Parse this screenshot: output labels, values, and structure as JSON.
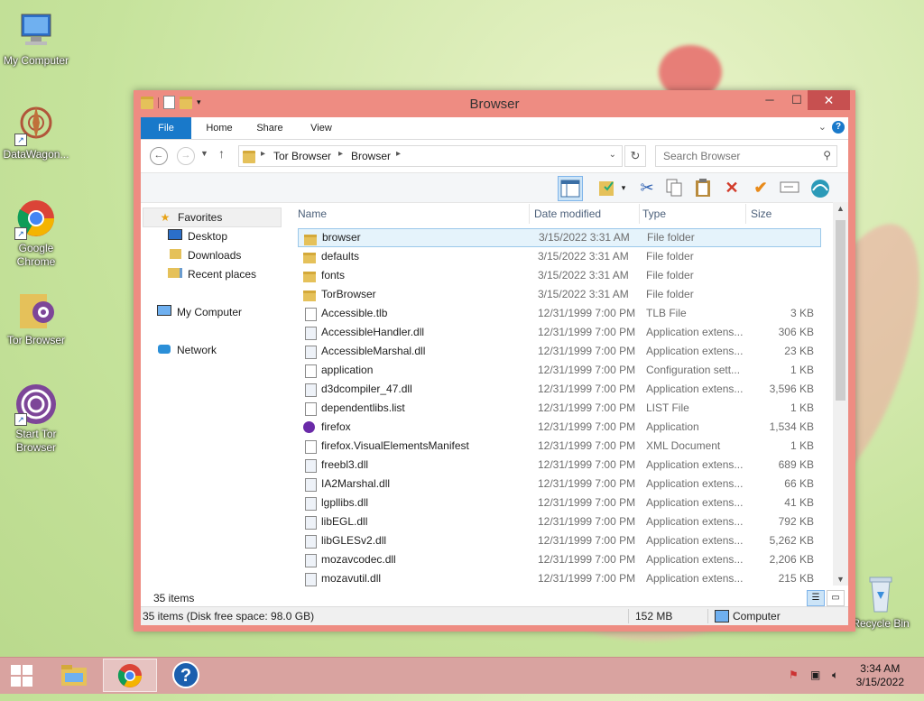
{
  "desktop": {
    "icons": [
      {
        "label": "My Computer",
        "icon": "my-computer-icon"
      },
      {
        "label": "DataWagon...",
        "icon": "datawagon-icon"
      },
      {
        "label": "Google Chrome",
        "icon": "chrome-icon"
      },
      {
        "label": "Tor Browser",
        "icon": "tor-folder-icon"
      },
      {
        "label": "Start Tor Browser",
        "icon": "tor-icon"
      },
      {
        "label": "Recycle Bin",
        "icon": "recycle-bin-icon"
      }
    ]
  },
  "window": {
    "title": "Browser",
    "ribbon": {
      "file": "File",
      "home": "Home",
      "share": "Share",
      "view": "View"
    },
    "address": {
      "crumb1": "Tor Browser",
      "crumb2": "Browser"
    },
    "search": {
      "placeholder": "Search Browser"
    },
    "nav": {
      "favorites": "Favorites",
      "desktop": "Desktop",
      "downloads": "Downloads",
      "recent": "Recent places",
      "computer": "My Computer",
      "network": "Network"
    },
    "columns": {
      "name": "Name",
      "date": "Date modified",
      "type": "Type",
      "size": "Size"
    },
    "files": [
      {
        "name": "browser",
        "date": "3/15/2022 3:31 AM",
        "type": "File folder",
        "size": "",
        "kind": "folder"
      },
      {
        "name": "defaults",
        "date": "3/15/2022 3:31 AM",
        "type": "File folder",
        "size": "",
        "kind": "folder"
      },
      {
        "name": "fonts",
        "date": "3/15/2022 3:31 AM",
        "type": "File folder",
        "size": "",
        "kind": "folder"
      },
      {
        "name": "TorBrowser",
        "date": "3/15/2022 3:31 AM",
        "type": "File folder",
        "size": "",
        "kind": "folder"
      },
      {
        "name": "Accessible.tlb",
        "date": "12/31/1999 7:00 PM",
        "type": "TLB File",
        "size": "3 KB",
        "kind": "file"
      },
      {
        "name": "AccessibleHandler.dll",
        "date": "12/31/1999 7:00 PM",
        "type": "Application extens...",
        "size": "306 KB",
        "kind": "dll"
      },
      {
        "name": "AccessibleMarshal.dll",
        "date": "12/31/1999 7:00 PM",
        "type": "Application extens...",
        "size": "23 KB",
        "kind": "dll"
      },
      {
        "name": "application",
        "date": "12/31/1999 7:00 PM",
        "type": "Configuration sett...",
        "size": "1 KB",
        "kind": "file"
      },
      {
        "name": "d3dcompiler_47.dll",
        "date": "12/31/1999 7:00 PM",
        "type": "Application extens...",
        "size": "3,596 KB",
        "kind": "dll"
      },
      {
        "name": "dependentlibs.list",
        "date": "12/31/1999 7:00 PM",
        "type": "LIST File",
        "size": "1 KB",
        "kind": "file"
      },
      {
        "name": "firefox",
        "date": "12/31/1999 7:00 PM",
        "type": "Application",
        "size": "1,534 KB",
        "kind": "ff"
      },
      {
        "name": "firefox.VisualElementsManifest",
        "date": "12/31/1999 7:00 PM",
        "type": "XML Document",
        "size": "1 KB",
        "kind": "file"
      },
      {
        "name": "freebl3.dll",
        "date": "12/31/1999 7:00 PM",
        "type": "Application extens...",
        "size": "689 KB",
        "kind": "dll"
      },
      {
        "name": "IA2Marshal.dll",
        "date": "12/31/1999 7:00 PM",
        "type": "Application extens...",
        "size": "66 KB",
        "kind": "dll"
      },
      {
        "name": "lgpllibs.dll",
        "date": "12/31/1999 7:00 PM",
        "type": "Application extens...",
        "size": "41 KB",
        "kind": "dll"
      },
      {
        "name": "libEGL.dll",
        "date": "12/31/1999 7:00 PM",
        "type": "Application extens...",
        "size": "792 KB",
        "kind": "dll"
      },
      {
        "name": "libGLESv2.dll",
        "date": "12/31/1999 7:00 PM",
        "type": "Application extens...",
        "size": "5,262 KB",
        "kind": "dll"
      },
      {
        "name": "mozavcodec.dll",
        "date": "12/31/1999 7:00 PM",
        "type": "Application extens...",
        "size": "2,206 KB",
        "kind": "dll"
      },
      {
        "name": "mozavutil.dll",
        "date": "12/31/1999 7:00 PM",
        "type": "Application extens...",
        "size": "215 KB",
        "kind": "dll"
      }
    ],
    "status_count": "35 items",
    "info": {
      "summary": "35 items (Disk free space: 98.0 GB)",
      "size": "152 MB",
      "location": "Computer"
    }
  },
  "taskbar": {
    "clock_time": "3:34 AM",
    "clock_date": "3/15/2022"
  },
  "colors": {
    "accent": "#1979ca",
    "window_frame": "#ee8c82",
    "close": "#c75050",
    "taskbar": "#d9a3a0"
  }
}
